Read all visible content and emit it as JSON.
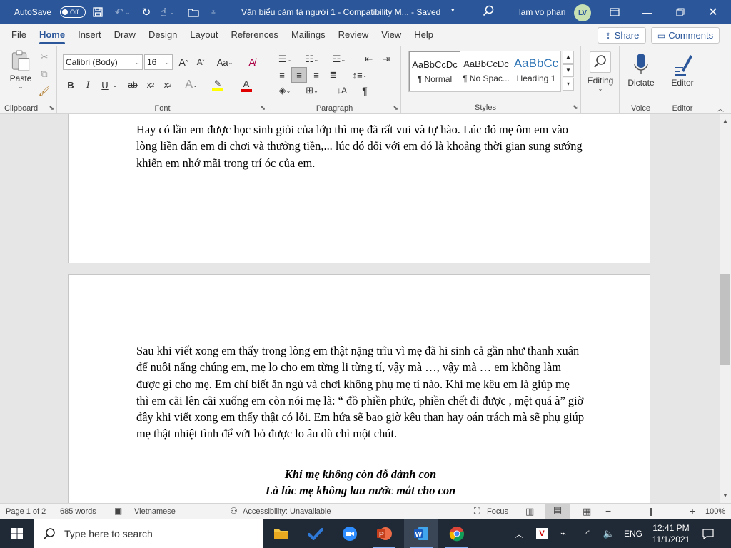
{
  "titlebar": {
    "autosave_label": "AutoSave",
    "autosave_state": "Off",
    "document_title": "Văn biểu cảm tả người 1  -  Compatibility M...  -  Saved",
    "user_name": "lam vo phan",
    "user_initials": "LV"
  },
  "menu": {
    "tabs": [
      "File",
      "Home",
      "Insert",
      "Draw",
      "Design",
      "Layout",
      "References",
      "Mailings",
      "Review",
      "View",
      "Help"
    ],
    "share_label": "Share",
    "comments_label": "Comments"
  },
  "ribbon": {
    "clipboard": {
      "paste_label": "Paste",
      "group_label": "Clipboard"
    },
    "font": {
      "font_name": "Calibri (Body)",
      "font_size": "16",
      "group_label": "Font"
    },
    "paragraph": {
      "group_label": "Paragraph"
    },
    "styles": {
      "group_label": "Styles",
      "items": [
        {
          "sample": "AaBbCcDc",
          "name": "¶ Normal"
        },
        {
          "sample": "AaBbCcDc",
          "name": "¶ No Spac..."
        },
        {
          "sample": "AaBbCc",
          "name": "Heading 1"
        }
      ]
    },
    "editing_label": "Editing",
    "dictate_label": "Dictate",
    "voice_label": "Voice",
    "editor_label": "Editor",
    "editor_group_label": "Editor"
  },
  "document": {
    "page1_paragraph": "Hay có lần em được học sinh giỏi của lớp thì mẹ đã rất vui và tự hào. Lúc đó mẹ ôm em vào lòng liền dẫn em đi chơi và thưởng tiền,... lúc đó đối với em đó là khoảng thời gian sung sướng khiến em nhớ mãi trong trí óc của em.",
    "page2_paragraph": "Sau khi viết xong em thấy trong lòng em thật nặng trĩu vì mẹ đã hi sinh cả gần như thanh xuân để nuôi nấng chúng em, mẹ lo cho em từng li từng tí, vậy mà …, vậy mà … em không làm được gì cho mẹ. Em chỉ biết ăn ngủ và chơi không phụ mẹ tí nào. Khi mẹ kêu em là giúp mẹ thì em cãi lên cãi xuống em còn nói mẹ là: “ đồ phiền phức, phiền chết đi được , mệt quá à” giờ đây khi viết xong em thấy thật có lỗi. Em hứa sẽ bao giờ kêu than  hay oán trách mà sẽ phụ giúp mẹ thật nhiệt tình để vứt bỏ được lo âu dù chỉ một chút.",
    "poem_line1": "Khi mẹ không còn dỗ dành con",
    "poem_line2": "Là lúc mẹ không lau nước mắt cho con"
  },
  "status": {
    "page": "Page 1 of 2",
    "words": "685 words",
    "language": "Vietnamese",
    "accessibility": "Accessibility: Unavailable",
    "focus": "Focus",
    "zoom": "100%"
  },
  "taskbar": {
    "search_placeholder": "Type here to search",
    "language": "ENG",
    "time": "12:41 PM",
    "date": "11/1/2021"
  },
  "colors": {
    "word_blue": "#2b579a",
    "taskbar": "#202a36"
  }
}
